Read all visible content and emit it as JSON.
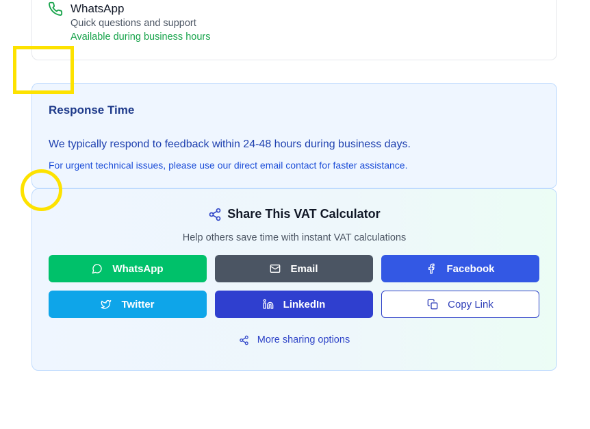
{
  "contact": {
    "whatsapp": {
      "icon": "phone-icon",
      "title": "WhatsApp",
      "subtitle": "Quick questions and support",
      "availability": "Available during business hours"
    }
  },
  "response": {
    "title": "Response Time",
    "body": "We typically respond to feedback within 24-48 hours during business days.",
    "note": "For urgent technical issues, please use our direct email contact for faster assistance."
  },
  "share": {
    "icon": "share-icon",
    "title": "Share This VAT Calculator",
    "subtitle": "Help others save time with instant VAT calculations",
    "buttons": [
      {
        "label": "WhatsApp",
        "icon": "message-circle-icon",
        "color": "#00c16a"
      },
      {
        "label": "Email",
        "icon": "mail-icon",
        "color": "#4b5563"
      },
      {
        "label": "Facebook",
        "icon": "facebook-icon",
        "color": "#3358e4"
      },
      {
        "label": "Twitter",
        "icon": "twitter-icon",
        "color": "#0ea5e9"
      },
      {
        "label": "LinkedIn",
        "icon": "linkedin-icon",
        "color": "#2f3fcf"
      },
      {
        "label": "Copy Link",
        "icon": "copy-icon",
        "color": "#ffffff"
      }
    ],
    "more_label": "More sharing options"
  },
  "colors": {
    "availability_green": "#16a34a",
    "response_bg": "#eff6ff",
    "highlight_yellow": "#fde200"
  }
}
